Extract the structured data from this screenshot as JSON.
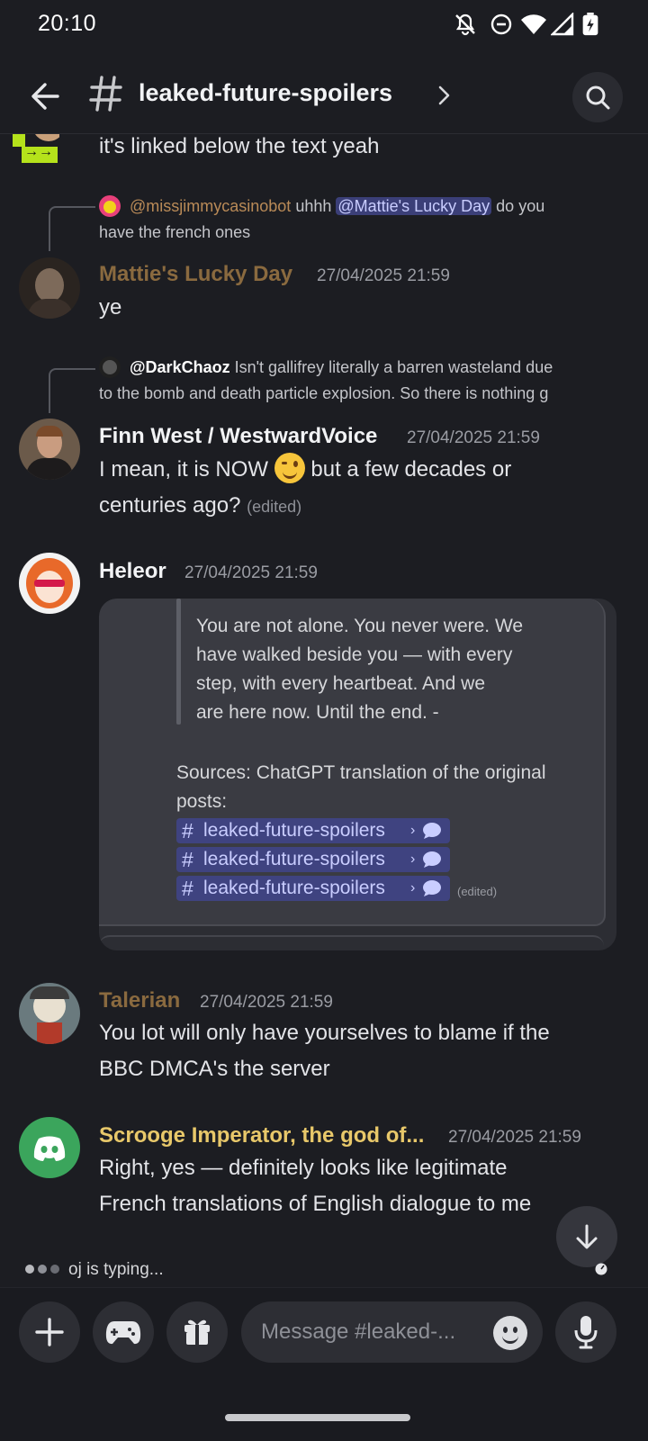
{
  "status_bar": {
    "time": "20:10"
  },
  "header": {
    "channel_name": "leaked-future-spoilers"
  },
  "messages": {
    "partial": {
      "text": "it's linked below the text yeah"
    },
    "mattie": {
      "reply_author": "@missjimmycasinobot",
      "reply_prefix": "uhhh",
      "reply_mention": "@Mattie's Lucky Day",
      "reply_suffix": "do you",
      "reply_line2": "have the french ones",
      "username": "Mattie's Lucky Day",
      "timestamp": "27/04/2025 21:59",
      "text": "ye",
      "username_color": "#8a6a3f"
    },
    "finn": {
      "reply_author": "@DarkChaoz",
      "reply_line1": "Isn't gallifrey literally a barren wasteland due",
      "reply_line2": "to the bomb and death particle explosion. So there is nothing g",
      "username": "Finn West / WestwardVoice",
      "timestamp": "27/04/2025 21:59",
      "text_line1_before": "I mean, it is NOW",
      "text_line1_after": "but a few decades or",
      "text_line2": "centuries ago?",
      "edited": "(edited)"
    },
    "heleor": {
      "username": "Heleor",
      "timestamp": "27/04/2025 21:59",
      "embed": {
        "quote_lines": [
          "You are not alone. You never were. We",
          "have walked beside you — with every",
          "step, with every heartbeat. And we",
          "are here now. Until the end. -"
        ],
        "sources_line1": "Sources: ChatGPT translation of the original",
        "sources_line2": "posts:",
        "links": [
          "leaked-future-spoilers",
          "leaked-future-spoilers",
          "leaked-future-spoilers"
        ],
        "edited": "(edited)"
      }
    },
    "talerian": {
      "username": "Talerian",
      "timestamp": "27/04/2025 21:59",
      "text_line1": "You lot will only have yourselves to blame if the",
      "text_line2": "BBC DMCA's the server",
      "username_color": "#8a6a3f"
    },
    "scrooge": {
      "username": "Scrooge Imperator, the god of...",
      "timestamp": "27/04/2025 21:59",
      "text_line1": "Right, yes — definitely looks like legitimate",
      "text_line2": "French translations of English dialogue to me",
      "username_color": "#e8c86a"
    }
  },
  "typing": {
    "text": "oj is typing..."
  },
  "composer": {
    "placeholder": "Message #leaked-..."
  },
  "colors": {
    "background": "#1c1d22",
    "mention_bg": "#3b3f78",
    "blurple": "#5865f2",
    "green": "#3ba55c"
  }
}
